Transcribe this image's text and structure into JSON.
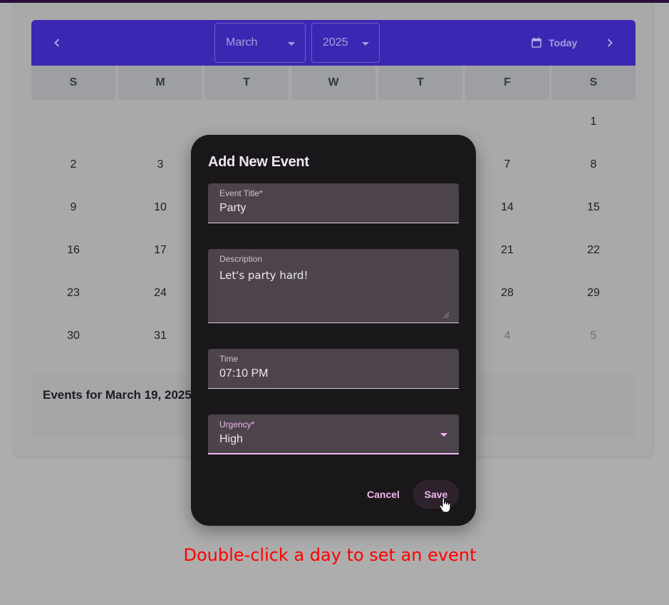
{
  "calendar": {
    "month": "March",
    "year": "2025",
    "today_label": "Today",
    "weekdays": [
      "S",
      "M",
      "T",
      "W",
      "T",
      "F",
      "S"
    ],
    "days": [
      {
        "label": "1"
      },
      {
        "label": "2"
      },
      {
        "label": "3"
      },
      {
        "label": "7"
      },
      {
        "label": "8"
      },
      {
        "label": "9"
      },
      {
        "label": "10"
      },
      {
        "label": "14"
      },
      {
        "label": "15"
      },
      {
        "label": "16"
      },
      {
        "label": "17"
      },
      {
        "label": "21"
      },
      {
        "label": "22"
      },
      {
        "label": "23"
      },
      {
        "label": "24"
      },
      {
        "label": "28"
      },
      {
        "label": "29"
      },
      {
        "label": "30"
      },
      {
        "label": "31"
      },
      {
        "label": "4"
      },
      {
        "label": "5"
      }
    ],
    "colors": {
      "header": "#3a28b3"
    }
  },
  "events_panel": {
    "title": "Events for March 19, 2025"
  },
  "dialog": {
    "title": "Add New Event",
    "event_title": {
      "label": "Event Title*",
      "value": "Party"
    },
    "description": {
      "label": "Description",
      "value": "Let's party hard!"
    },
    "time": {
      "label": "Time",
      "value": "07:10 PM"
    },
    "urgency": {
      "label": "Urgency*",
      "value": "High"
    },
    "cancel_label": "Cancel",
    "save_label": "Save",
    "accent": "#efb8ef"
  },
  "hint": "Double-click a day to set an event"
}
